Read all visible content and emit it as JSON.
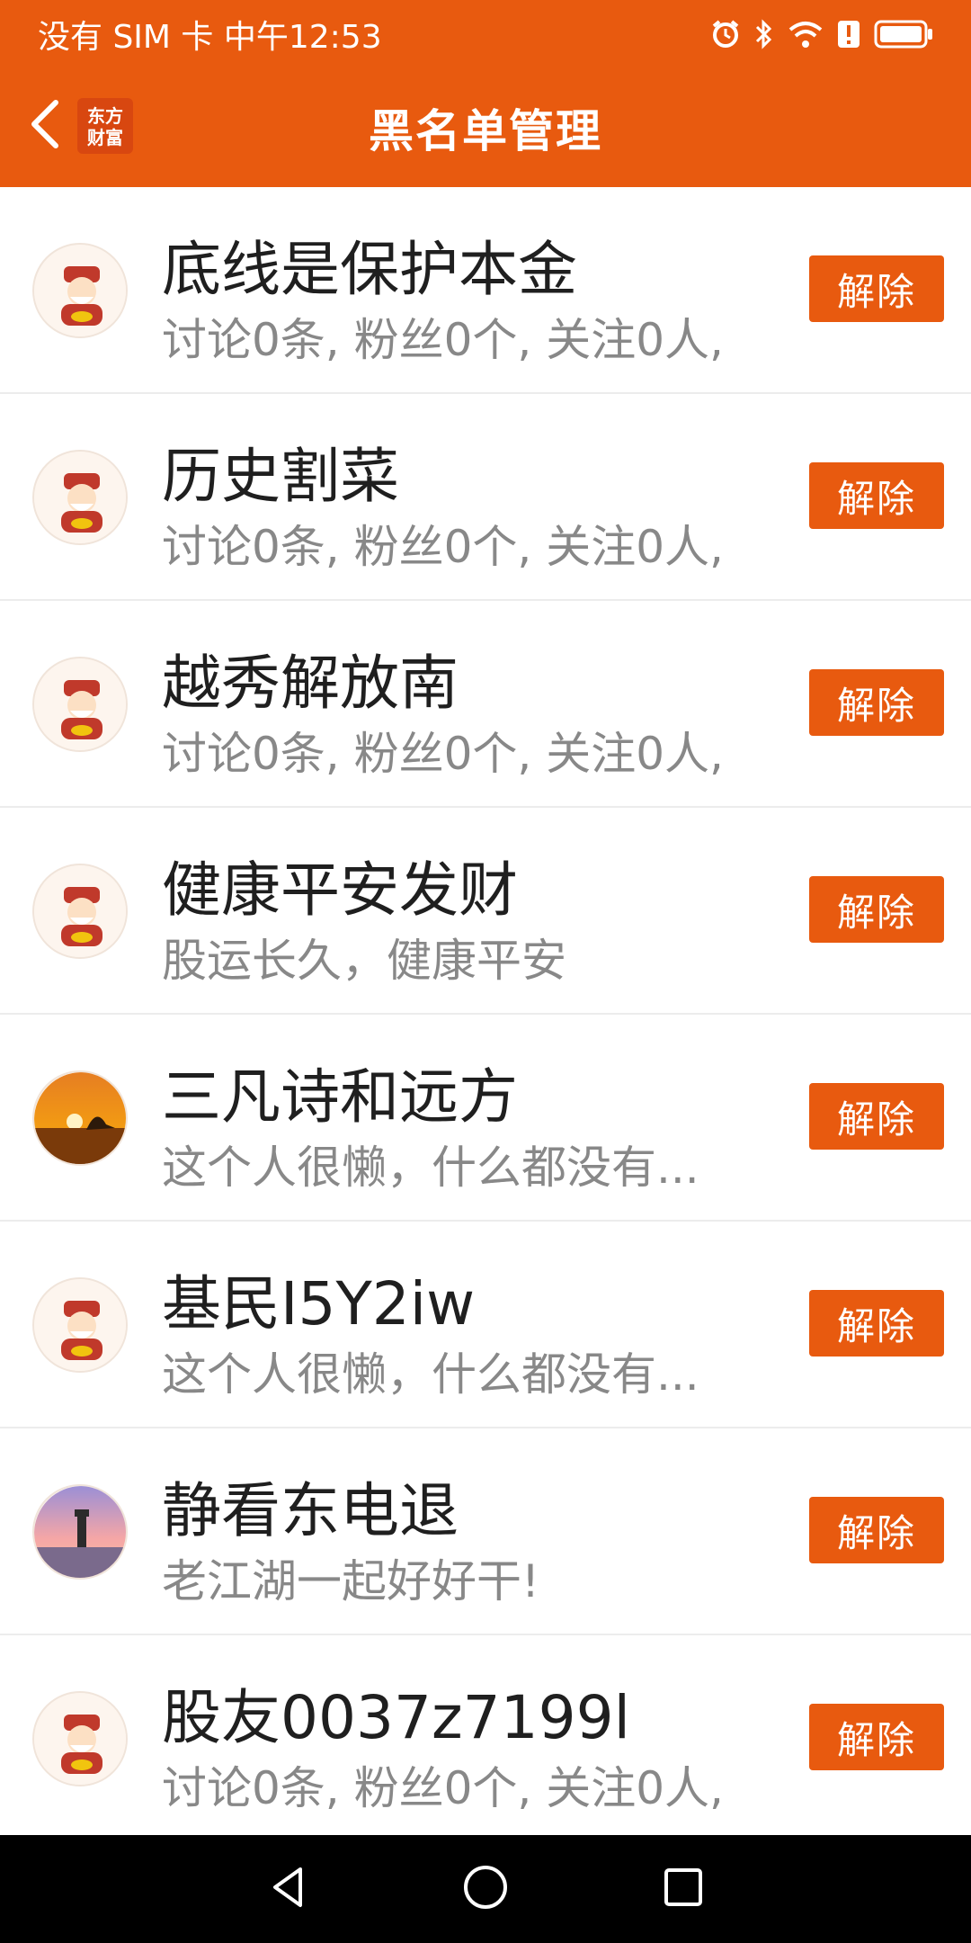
{
  "status_bar": {
    "carrier_time": "没有 SIM 卡 中午12:53",
    "icons": [
      "alarm-icon",
      "bluetooth-icon",
      "wifi-icon",
      "alert-icon",
      "battery-icon"
    ]
  },
  "header": {
    "title": "黑名单管理",
    "logo_line1": "东方",
    "logo_line2": "财富",
    "back_icon": "chevron-left-icon"
  },
  "blocked_users": [
    {
      "name": "底线是保护本金",
      "desc": "讨论0条, 粉丝0个, 关注0人,",
      "avatar": "fortune-god-avatar",
      "action": "解除"
    },
    {
      "name": "历史割菜",
      "desc": "讨论0条, 粉丝0个, 关注0人,",
      "avatar": "fortune-god-avatar",
      "action": "解除"
    },
    {
      "name": "越秀解放南",
      "desc": "讨论0条, 粉丝0个, 关注0人,",
      "avatar": "fortune-god-avatar",
      "action": "解除"
    },
    {
      "name": "健康平安发财",
      "desc": "股运长久，健康平安",
      "avatar": "fortune-god-avatar",
      "action": "解除"
    },
    {
      "name": "三凡诗和远方",
      "desc": "这个人很懒，什么都没有...",
      "avatar": "sunset-photo-avatar",
      "action": "解除"
    },
    {
      "name": "基民I5Y2iw",
      "desc": "这个人很懒，什么都没有...",
      "avatar": "fortune-god-avatar",
      "action": "解除"
    },
    {
      "name": "静看东电退",
      "desc": "老江湖一起好好干!",
      "avatar": "lighthouse-photo-avatar",
      "action": "解除"
    },
    {
      "name": "股友0037z7199l",
      "desc": "讨论0条, 粉丝0个, 关注0人,",
      "avatar": "fortune-god-avatar",
      "action": "解除"
    }
  ],
  "colors": {
    "accent": "#e85a0f",
    "name_text": "#1f1f1f",
    "desc_text": "#888888"
  },
  "nav_bar": {
    "icons": [
      "back-triangle-icon",
      "home-circle-icon",
      "recents-square-icon"
    ]
  }
}
